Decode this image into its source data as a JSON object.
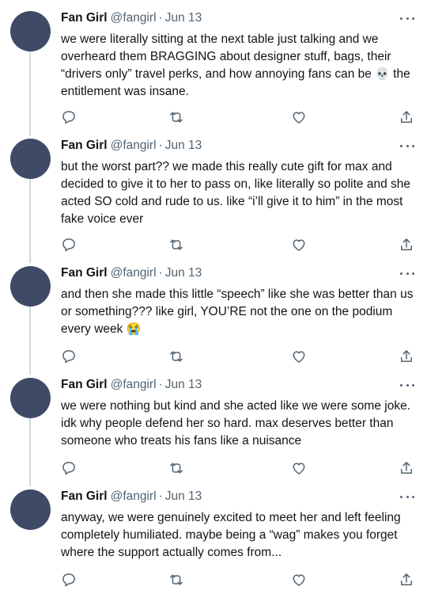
{
  "author": {
    "display_name": "Fan Girl",
    "handle": "@fangirl",
    "date": "Jun 13",
    "separator": "·"
  },
  "icons": {
    "more": "more-horizontal-icon",
    "reply": "reply-bubble-icon",
    "retweet": "retweet-icon",
    "like": "heart-icon",
    "share": "share-upload-icon"
  },
  "colors": {
    "avatar": "#3f4a66",
    "secondary_text": "#536471",
    "thread_line": "#cfd9de"
  },
  "tweets": [
    {
      "text": "we were literally sitting at the next table just talking and we overheard them BRAGGING about designer stuff, bags, their “drivers only” travel perks, and how annoying fans can be ",
      "emoji": "💀",
      "text_after": " the entitlement was insane."
    },
    {
      "text": "but the worst part?? we made this really cute gift for max and decided to give it to her to pass on, like literally so polite and she acted SO cold and rude to us. like “i’ll give it to him” in the most fake voice ever",
      "emoji": "",
      "text_after": ""
    },
    {
      "text": "and then she made this little “speech” like she was better than us or something??? like girl, YOU’RE not the one on the podium every week ",
      "emoji": "😭",
      "text_after": ""
    },
    {
      "text": "we were nothing but kind and she acted like we were some joke. idk why people defend her so hard. max deserves better than someone who treats his fans like a nuisance",
      "emoji": "",
      "text_after": ""
    },
    {
      "text": "anyway, we were genuinely excited to meet her and left feeling completely humiliated. maybe being a “wag” makes you forget where the support actually comes from...",
      "emoji": "",
      "text_after": ""
    }
  ]
}
